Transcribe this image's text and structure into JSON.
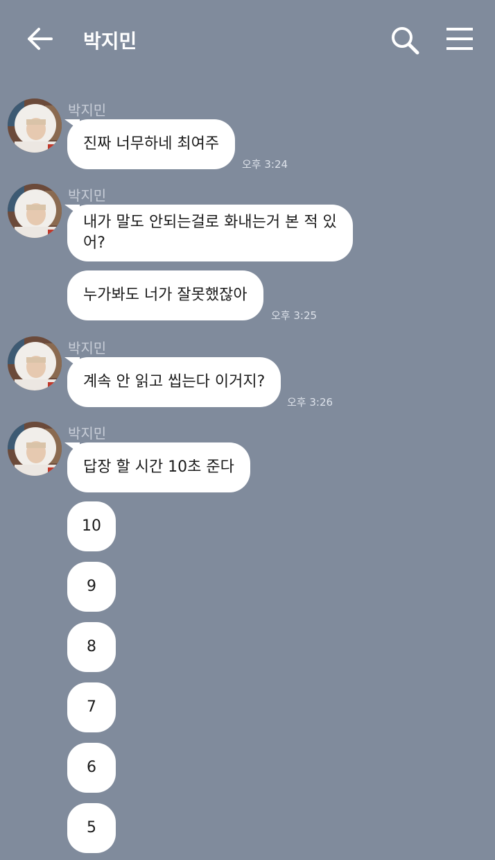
{
  "header": {
    "title": "박지민",
    "back_icon": "arrow-left-icon",
    "search_icon": "search-icon",
    "menu_icon": "hamburger-menu-icon"
  },
  "colors": {
    "background": "#808b9c",
    "bubble": "#ffffff",
    "text": "#1a1a1a",
    "sender_name": "#c8ced8",
    "time": "#dde2ea"
  },
  "messages": [
    {
      "sender": "박지민",
      "text": "진짜 너무하네 최여주",
      "time": "오후 3:24"
    },
    {
      "sender": "박지민",
      "text": "내가 말도 안되는걸로 화내는거 본 적 있어?"
    },
    {
      "text": "누가봐도 너가 잘못했잖아",
      "time": "오후 3:25"
    },
    {
      "sender": "박지민",
      "text": "계속 안 읽고 씹는다 이거지?",
      "time": "오후 3:26"
    },
    {
      "sender": "박지민",
      "text": "답장 할 시간 10초 준다"
    },
    {
      "text": "10"
    },
    {
      "text": "9"
    },
    {
      "text": "8"
    },
    {
      "text": "7"
    },
    {
      "text": "6"
    },
    {
      "text": "5"
    }
  ]
}
